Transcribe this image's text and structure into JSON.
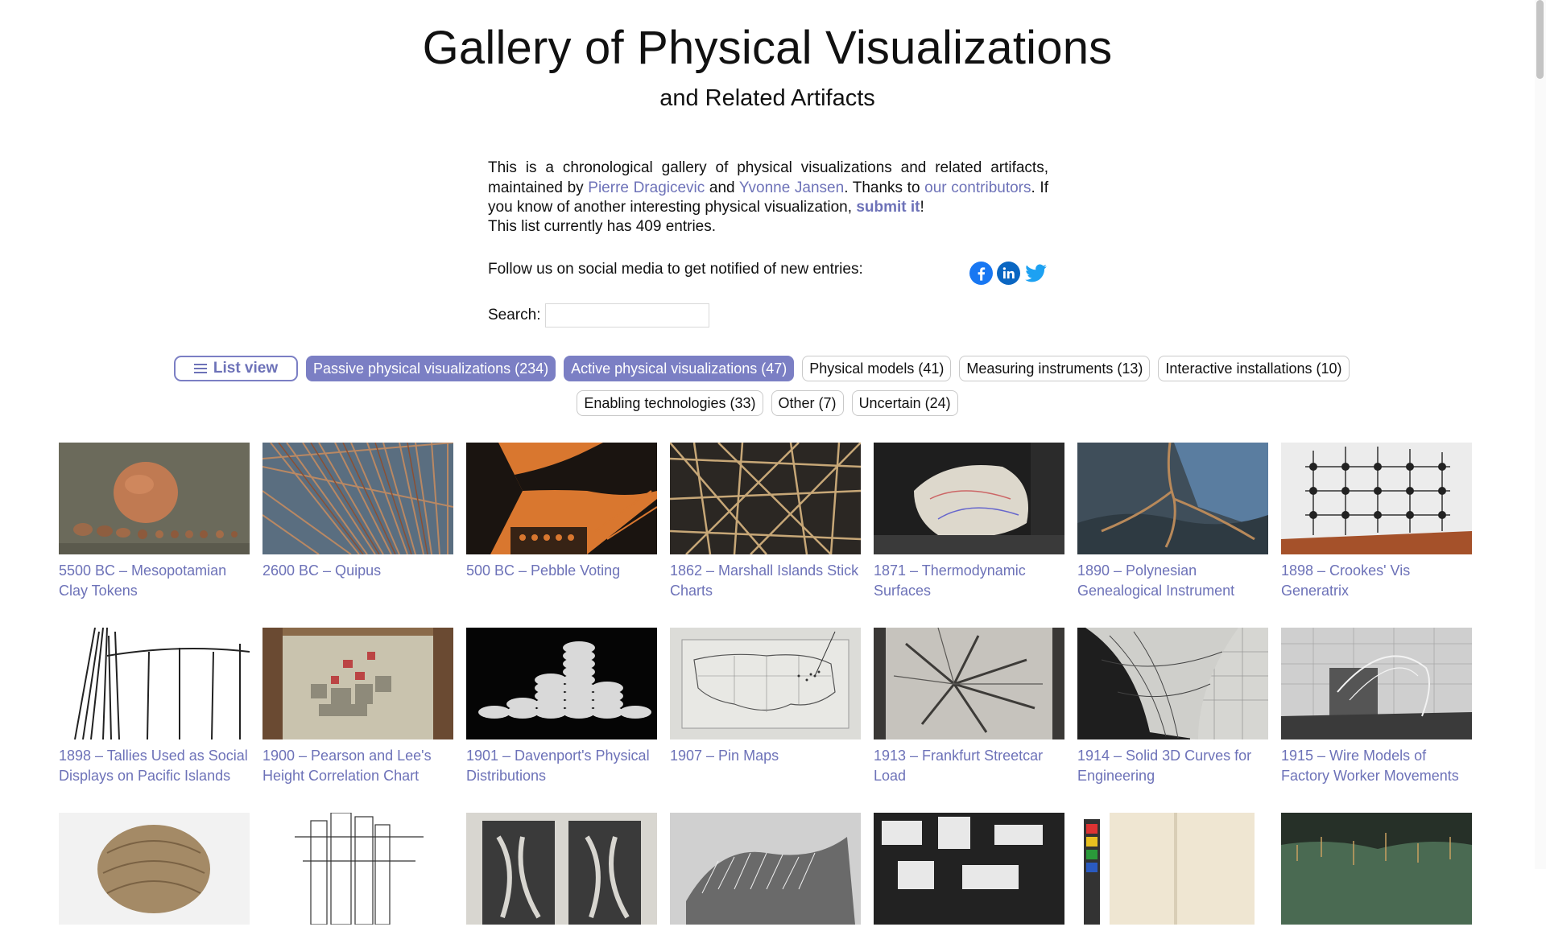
{
  "header": {
    "title": "Gallery of Physical Visualizations",
    "subtitle": "and Related Artifacts"
  },
  "intro": {
    "text1": "This is a chronological gallery of physical visualizations and related artifacts, maintained by ",
    "author1": "Pierre Dragicevic",
    "and": " and ",
    "author2": "Yvonne Jansen",
    "text2": ". Thanks to ",
    "contributors": "our contributors",
    "text3": ". If you know of another interesting physical visualization, ",
    "submit": "submit it",
    "text4": "!",
    "entries": "This list currently has 409 entries.",
    "follow": "Follow us on social media to get notified of new entries:"
  },
  "social": [
    {
      "icon": "facebook-icon",
      "color": "#1877f2"
    },
    {
      "icon": "linkedin-icon",
      "color": "#0a66c2"
    },
    {
      "icon": "twitter-icon",
      "color": "#1da1f2"
    }
  ],
  "search": {
    "label": "Search:",
    "value": ""
  },
  "filters": {
    "list_view": "List view",
    "row1": [
      {
        "label": "Passive physical visualizations (234)",
        "active": true
      },
      {
        "label": "Active physical visualizations (47)",
        "active": true
      },
      {
        "label": "Physical models (41)",
        "active": false
      },
      {
        "label": "Measuring instruments (13)",
        "active": false
      },
      {
        "label": "Interactive installations (10)",
        "active": false
      }
    ],
    "row2": [
      {
        "label": "Enabling technologies (33)",
        "active": false
      },
      {
        "label": "Other (7)",
        "active": false
      },
      {
        "label": "Uncertain (24)",
        "active": false
      }
    ]
  },
  "colors": {
    "accent": "#7b7fc4",
    "link": "#6d72b8"
  },
  "gallery": [
    {
      "caption": "5500 BC – Mesopotamian Clay Tokens"
    },
    {
      "caption": "2600 BC – Quipus"
    },
    {
      "caption": "500 BC – Pebble Voting"
    },
    {
      "caption": "1862 – Marshall Islands Stick Charts"
    },
    {
      "caption": "1871 – Thermodynamic Surfaces"
    },
    {
      "caption": "1890 – Polynesian Genealogical Instrument"
    },
    {
      "caption": "1898 – Crookes' Vis Generatrix"
    },
    {
      "caption": "1898 – Tallies Used as Social Displays on Pacific Islands"
    },
    {
      "caption": "1900 – Pearson and Lee's Height Correlation Chart"
    },
    {
      "caption": "1901 – Davenport's Physical Distributions"
    },
    {
      "caption": "1907 – Pin Maps"
    },
    {
      "caption": "1913 – Frankfurt Streetcar Load"
    },
    {
      "caption": "1914 – Solid 3D Curves for Engineering"
    },
    {
      "caption": "1915 – Wire Models of Factory Worker Movements"
    },
    {
      "caption": ""
    },
    {
      "caption": ""
    },
    {
      "caption": ""
    },
    {
      "caption": ""
    },
    {
      "caption": ""
    },
    {
      "caption": ""
    },
    {
      "caption": ""
    }
  ]
}
